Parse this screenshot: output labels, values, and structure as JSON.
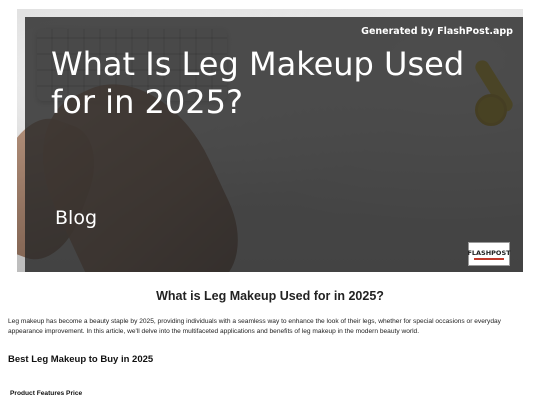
{
  "hero": {
    "generated_by": "Generated by FlashPost.app",
    "title": "What Is Leg Makeup Used for in 2025?",
    "tag": "Blog",
    "logo_text_a": "FLASH",
    "logo_text_b": "POST"
  },
  "article": {
    "title": "What is Leg Makeup Used for in 2025?",
    "intro": "Leg makeup has become a beauty staple by 2025, providing individuals with a seamless way to enhance the look of their legs, whether for special occasions or everyday appearance improvement. In this article, we'll delve into the multifaceted applications and benefits of leg makeup in the modern beauty world.",
    "section_heading": "Best Leg Makeup to Buy in 2025",
    "table_header": "Product Features Price"
  },
  "colors": {
    "overlay": "#282828",
    "watch": "#e2c21c",
    "logo_accent": "#c0392b"
  }
}
